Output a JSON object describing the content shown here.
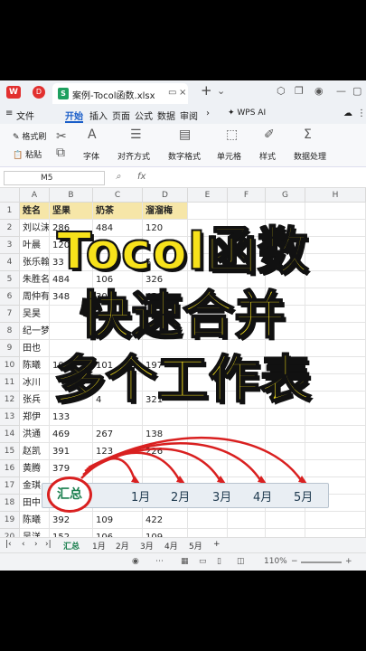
{
  "window": {
    "file_tab": "案例-Tocol函数.xlsx"
  },
  "menu": {
    "items": [
      "文件",
      "开始",
      "插入",
      "页面",
      "公式",
      "数据",
      "审阅"
    ],
    "active": "开始",
    "wps_ai": "WPS AI"
  },
  "ribbon": {
    "format_painter": "格式刷",
    "paste": "粘贴",
    "font": "字体",
    "align": "对齐方式",
    "number_format": "数字格式",
    "cell": "单元格",
    "style": "样式",
    "data_process": "数据处理"
  },
  "formula_bar": {
    "cell_ref": "M5",
    "fx": "fx"
  },
  "columns": [
    "A",
    "B",
    "C",
    "D",
    "E",
    "F",
    "G",
    "H"
  ],
  "rows": [
    [
      "1",
      "姓名",
      "坚果",
      "奶茶",
      "溜溜梅"
    ],
    [
      "2",
      "刘以沫",
      "286",
      "484",
      "120"
    ],
    [
      "3",
      "叶晨",
      "120",
      "",
      ""
    ],
    [
      "4",
      "张乐翰",
      "33",
      "",
      "5"
    ],
    [
      "5",
      "朱胜名",
      "484",
      "106",
      "326"
    ],
    [
      "6",
      "周仲有",
      "348",
      "302",
      "458"
    ],
    [
      "7",
      "吴昊",
      "",
      "",
      ""
    ],
    [
      "8",
      "纪一梦",
      "",
      "",
      ""
    ],
    [
      "9",
      "田也",
      "",
      "",
      ""
    ],
    [
      "10",
      "陈曦",
      "100",
      "101",
      "197"
    ],
    [
      "11",
      "冰川",
      "",
      "",
      ""
    ],
    [
      "12",
      "张兵",
      "",
      "4",
      "321"
    ],
    [
      "13",
      "郑伊",
      "133",
      "",
      ""
    ],
    [
      "14",
      "洪通",
      "469",
      "267",
      "138"
    ],
    [
      "15",
      "赵凯",
      "391",
      "123",
      "226"
    ],
    [
      "16",
      "黄腾",
      "379",
      "",
      ""
    ],
    [
      "17",
      "金琪",
      "",
      "",
      ""
    ],
    [
      "18",
      "田中",
      "",
      "",
      ""
    ],
    [
      "19",
      "陈曦",
      "392",
      "109",
      "422"
    ],
    [
      "20",
      "吴洋",
      "152",
      "106",
      "109"
    ]
  ],
  "sheets": [
    "汇总",
    "1月",
    "2月",
    "3月",
    "4月",
    "5月"
  ],
  "active_sheet": "汇总",
  "status": {
    "zoom": "110%"
  },
  "overlay": {
    "line1": "Tocol函数",
    "line2": "快速合并",
    "line3": "多个工作表"
  },
  "strip": {
    "active": "汇总",
    "tabs": [
      "1月",
      "2月",
      "3月",
      "4月",
      "5月"
    ]
  }
}
